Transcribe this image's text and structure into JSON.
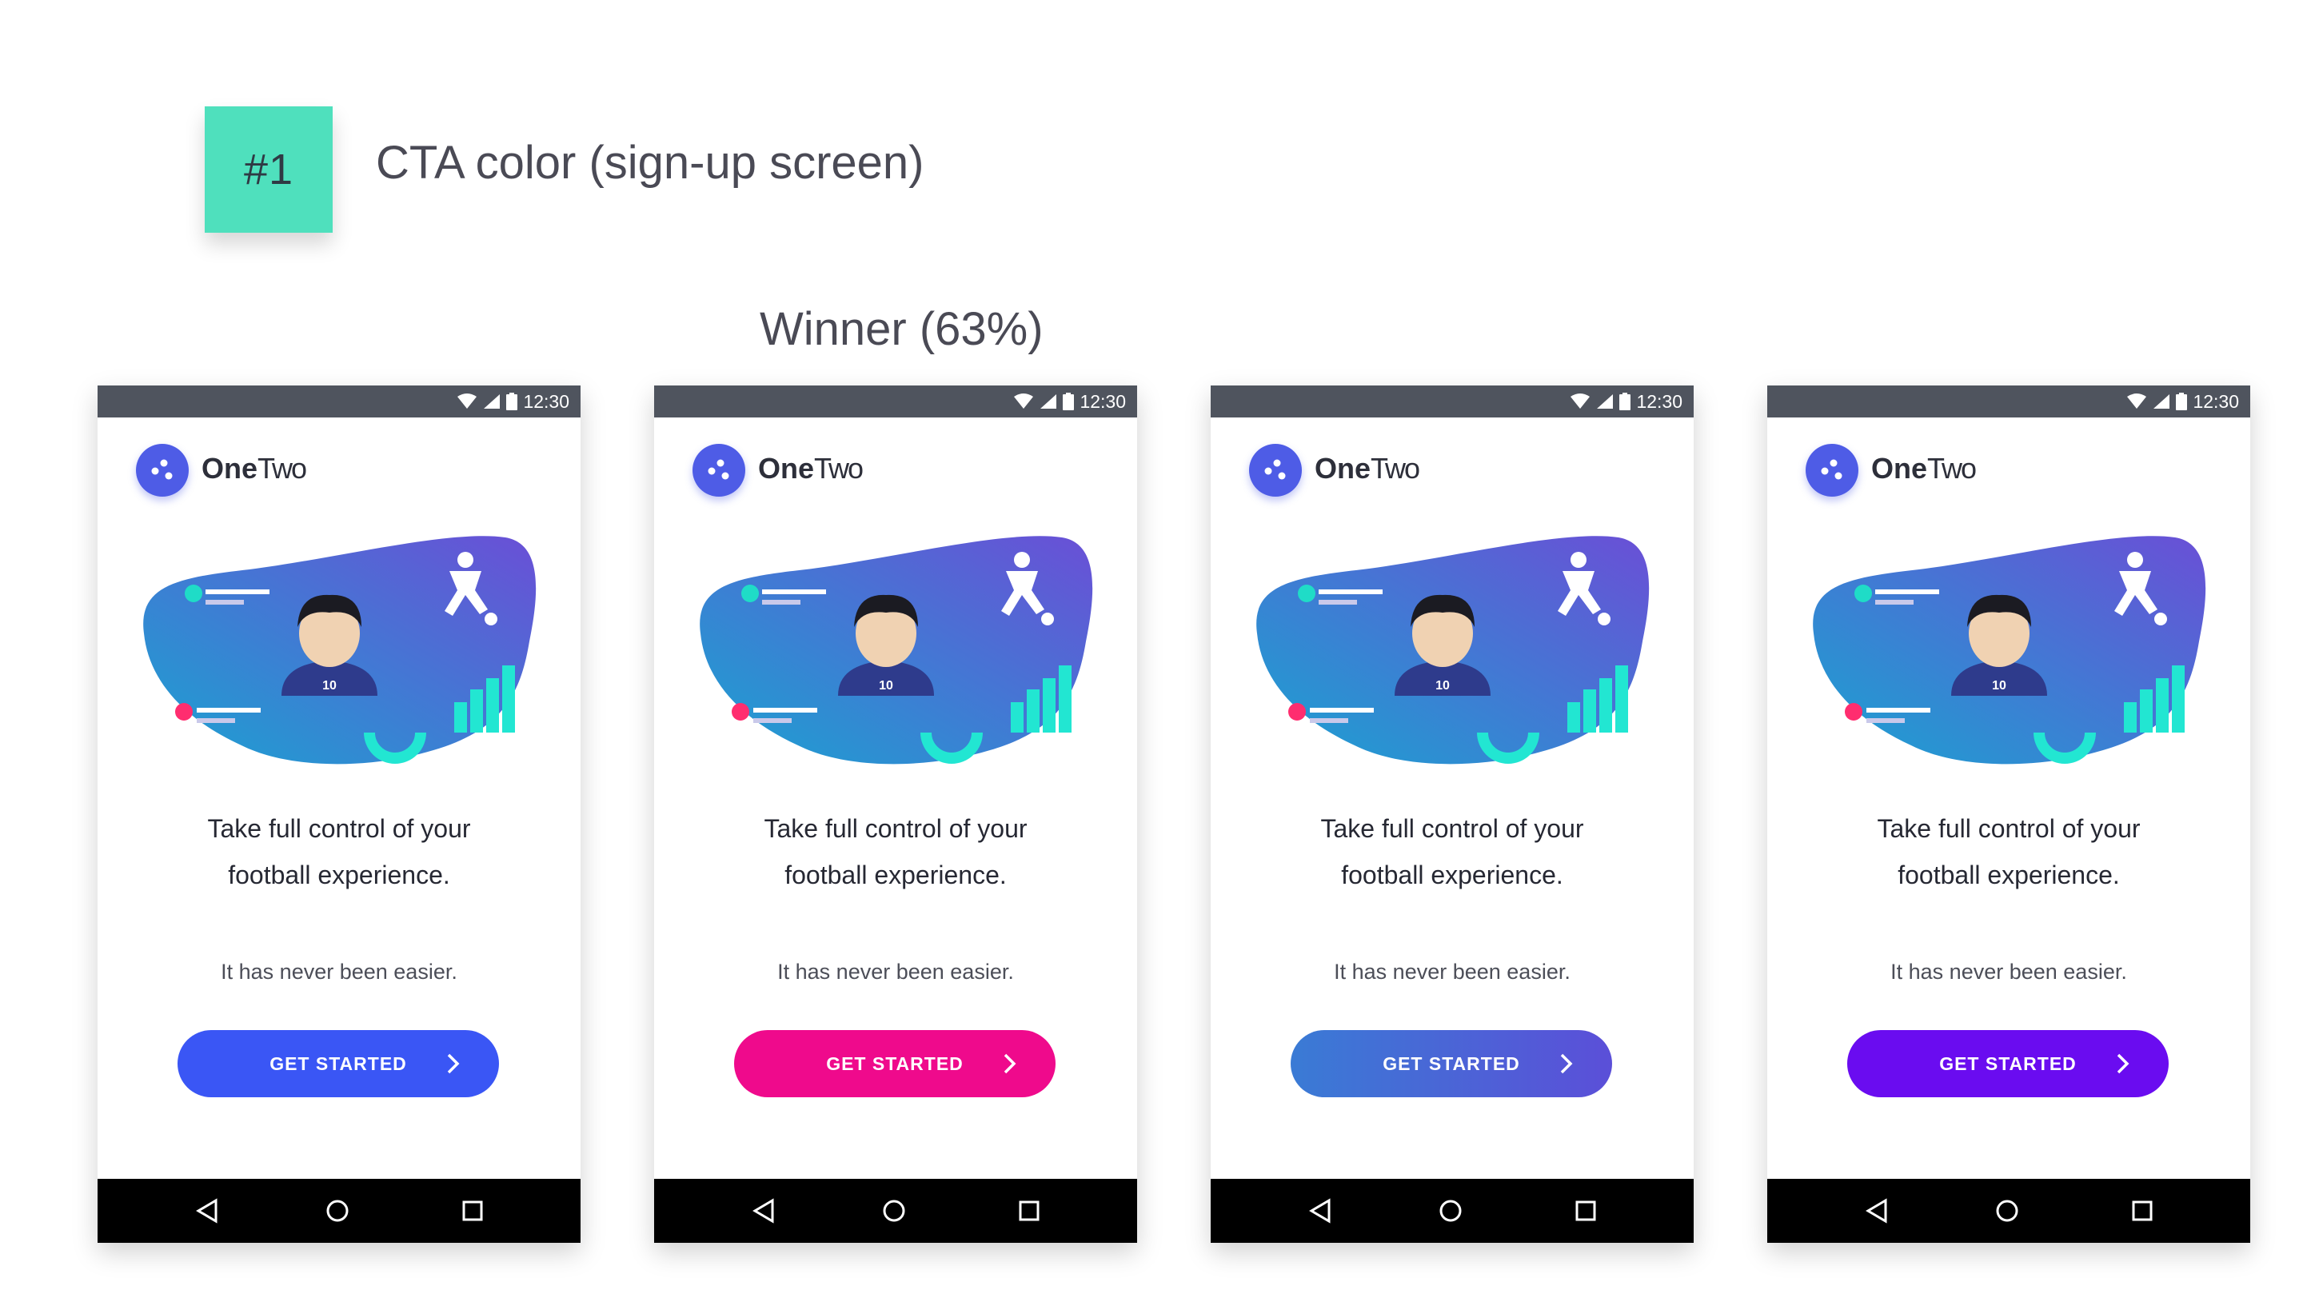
{
  "badge": {
    "label": "#1",
    "color": "#4fe0bd"
  },
  "heading": "CTA color (sign-up screen)",
  "winner_label": "Winner (63%)",
  "phones": [
    {
      "status": {
        "time": "12:30",
        "icons": [
          "wifi-icon",
          "signal-icon",
          "battery-icon"
        ]
      },
      "brand": {
        "one": "One",
        "two": "Two"
      },
      "illustration": {
        "jersey_number": "10"
      },
      "headline_line1": "Take full control of your",
      "headline_line2": "football experience.",
      "subtitle": "It has never been easier.",
      "cta": {
        "label": "GET STARTED",
        "color": "#3a56f5"
      },
      "nav": [
        "back-icon",
        "home-icon",
        "recents-icon"
      ]
    },
    {
      "status": {
        "time": "12:30",
        "icons": [
          "wifi-icon",
          "signal-icon",
          "battery-icon"
        ]
      },
      "brand": {
        "one": "One",
        "two": "Two"
      },
      "illustration": {
        "jersey_number": "10"
      },
      "headline_line1": "Take full control of your",
      "headline_line2": "football experience.",
      "subtitle": "It has never been easier.",
      "cta": {
        "label": "GET STARTED",
        "color": "#ef0a8c"
      },
      "nav": [
        "back-icon",
        "home-icon",
        "recents-icon"
      ]
    },
    {
      "status": {
        "time": "12:30",
        "icons": [
          "wifi-icon",
          "signal-icon",
          "battery-icon"
        ]
      },
      "brand": {
        "one": "One",
        "two": "Two"
      },
      "illustration": {
        "jersey_number": "10"
      },
      "headline_line1": "Take full control of your",
      "headline_line2": "football experience.",
      "subtitle": "It has never been easier.",
      "cta": {
        "label": "GET STARTED",
        "color_from": "#3a7bd5",
        "color_to": "#5b4fd8"
      },
      "nav": [
        "back-icon",
        "home-icon",
        "recents-icon"
      ]
    },
    {
      "status": {
        "time": "12:30",
        "icons": [
          "wifi-icon",
          "signal-icon",
          "battery-icon"
        ]
      },
      "brand": {
        "one": "One",
        "two": "Two"
      },
      "illustration": {
        "jersey_number": "10"
      },
      "headline_line1": "Take full control of your",
      "headline_line2": "football experience.",
      "subtitle": "It has never been easier.",
      "cta": {
        "label": "GET STARTED",
        "color": "#6a0cf0"
      },
      "nav": [
        "back-icon",
        "home-icon",
        "recents-icon"
      ]
    }
  ]
}
